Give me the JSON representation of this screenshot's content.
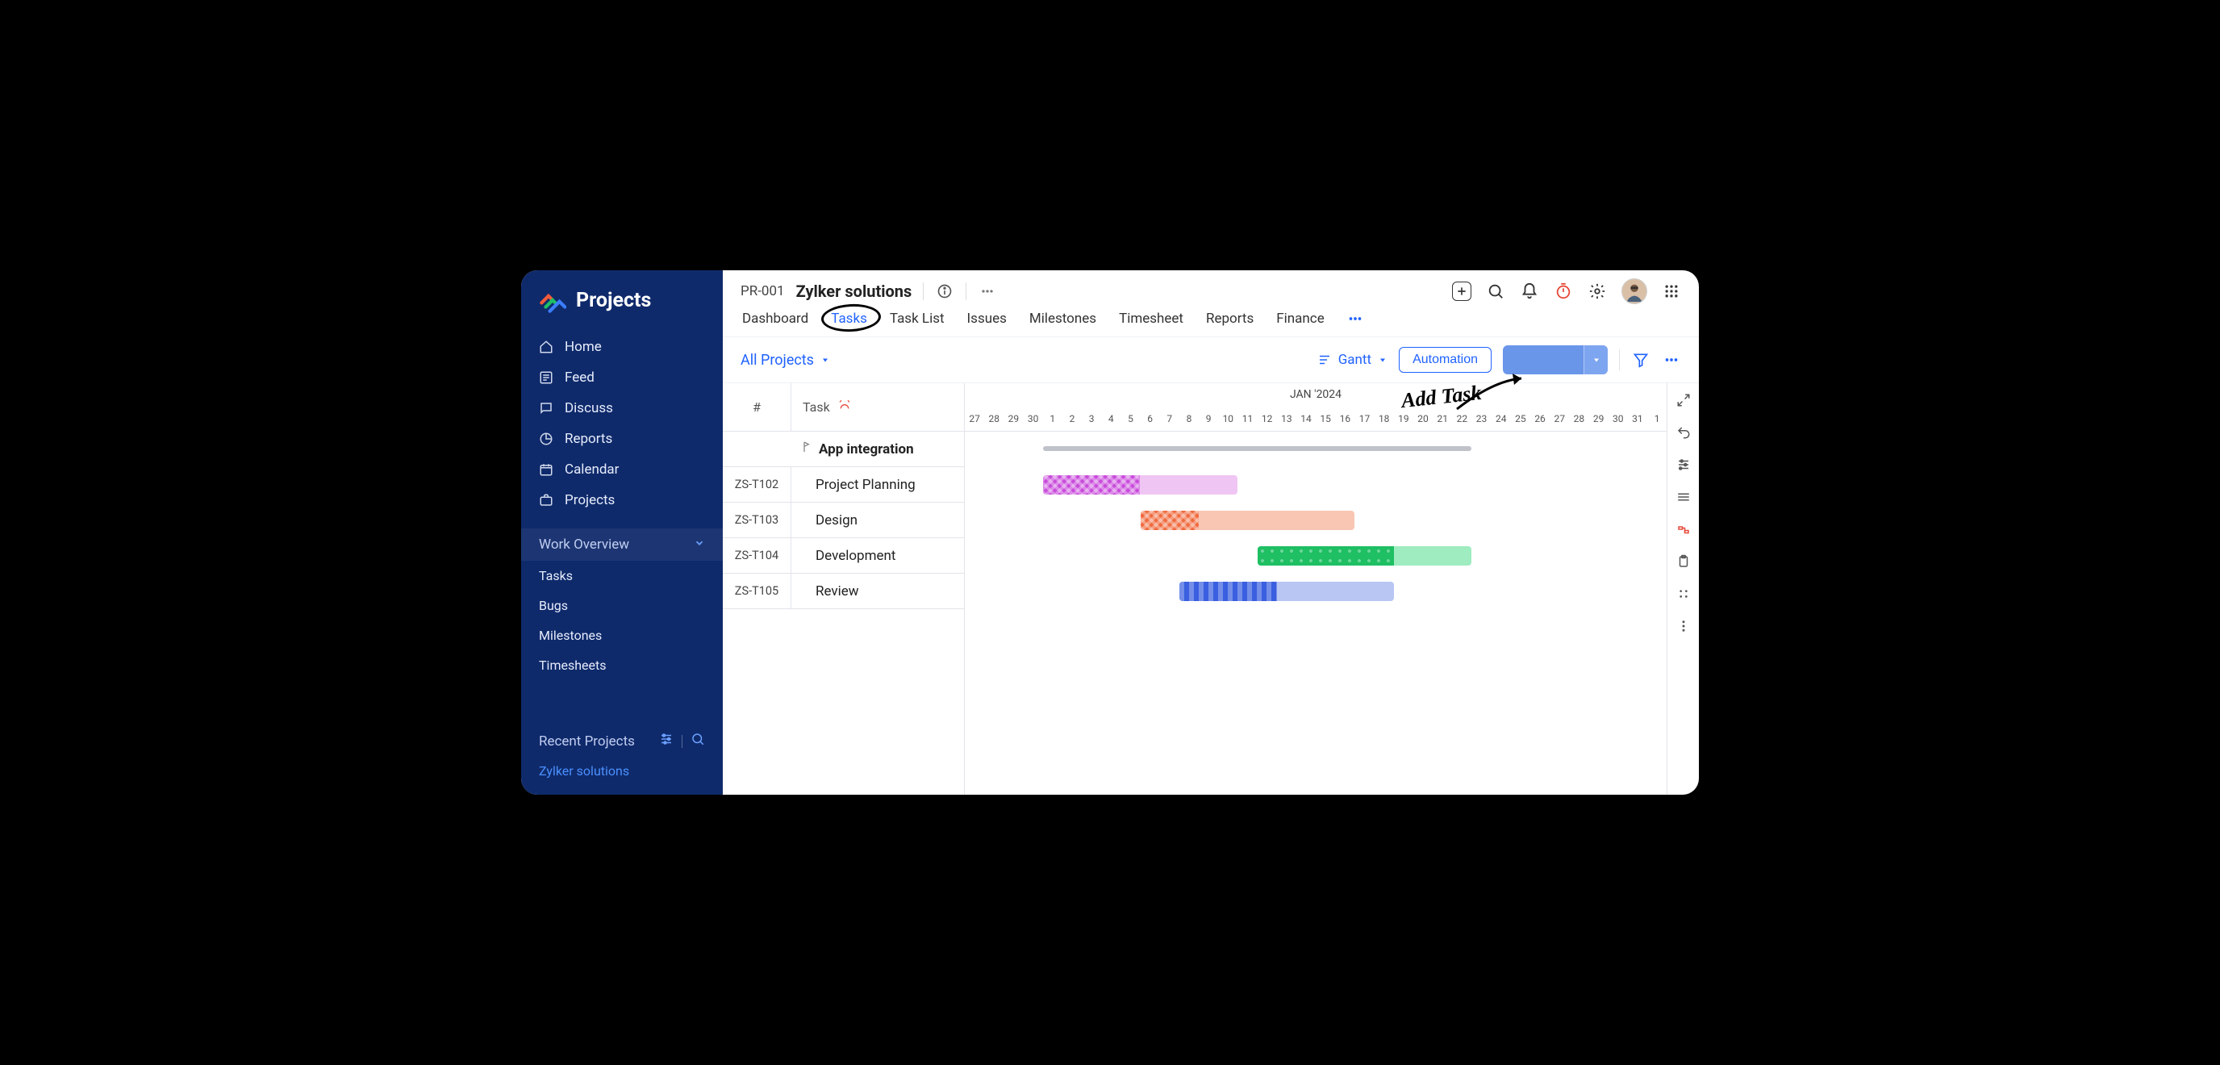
{
  "brand": "Projects",
  "sidebar": {
    "nav": [
      {
        "label": "Home",
        "icon": "home"
      },
      {
        "label": "Feed",
        "icon": "feed"
      },
      {
        "label": "Discuss",
        "icon": "discuss"
      },
      {
        "label": "Reports",
        "icon": "reports"
      },
      {
        "label": "Calendar",
        "icon": "calendar"
      },
      {
        "label": "Projects",
        "icon": "projects"
      }
    ],
    "section": "Work Overview",
    "sub": [
      "Tasks",
      "Bugs",
      "Milestones",
      "Timesheets"
    ],
    "recent_header": "Recent Projects",
    "recent": [
      "Zylker solutions"
    ]
  },
  "project": {
    "code": "PR-001",
    "name": "Zylker solutions"
  },
  "tabs": [
    "Dashboard",
    "Tasks",
    "Task List",
    "Issues",
    "Milestones",
    "Timesheet",
    "Reports",
    "Finance"
  ],
  "active_tab": "Tasks",
  "toolbar": {
    "scope": "All Projects",
    "view": "Gantt",
    "automation": "Automation"
  },
  "gantt": {
    "month": "JAN '2024",
    "days": [
      27,
      28,
      29,
      30,
      1,
      2,
      3,
      4,
      5,
      6,
      7,
      8,
      9,
      10,
      11,
      12,
      13,
      14,
      15,
      16,
      17,
      18,
      19,
      20,
      21,
      22,
      23,
      24,
      25,
      26,
      27,
      28,
      29,
      30,
      31,
      1
    ],
    "id_header": "#",
    "task_header": "Task",
    "group": "App integration",
    "rows": [
      {
        "id": "ZS-T102",
        "name": "Project Planning",
        "start": 4,
        "full": 14,
        "prog_end": 9,
        "c1": "#c94bdc",
        "c2": "#efc6f3"
      },
      {
        "id": "ZS-T103",
        "name": "Design",
        "start": 9,
        "full": 20,
        "prog_end": 12,
        "c1": "#f06a3e",
        "c2": "#f8c6b3"
      },
      {
        "id": "ZS-T104",
        "name": "Development",
        "start": 15,
        "full": 26,
        "prog_end": 22,
        "c1": "#1fbf63",
        "c2": "#9fecc0"
      },
      {
        "id": "ZS-T105",
        "name": "Review",
        "start": 11,
        "full": 22,
        "prog_end": 16,
        "c1": "#3a5fe0",
        "c2": "#b9c6f3"
      }
    ]
  },
  "annotation": "Add Task",
  "chart_data": {
    "type": "gantt",
    "title": "App integration — Gantt",
    "xlabel": "JAN '2024",
    "x_range": [
      "2023-12-27",
      "2024-02-01"
    ],
    "series": [
      {
        "id": "ZS-T102",
        "name": "Project Planning",
        "start": "2024-01-01",
        "end": "2024-01-14",
        "progress_end": "2024-01-06",
        "color": "#c94bdc"
      },
      {
        "id": "ZS-T103",
        "name": "Design",
        "start": "2024-01-06",
        "end": "2024-01-20",
        "progress_end": "2024-01-09",
        "color": "#f06a3e"
      },
      {
        "id": "ZS-T104",
        "name": "Development",
        "start": "2024-01-15",
        "end": "2024-01-26",
        "progress_end": "2024-01-22",
        "color": "#1fbf63"
      },
      {
        "id": "ZS-T105",
        "name": "Review",
        "start": "2024-01-08",
        "end": "2024-01-22",
        "progress_end": "2024-01-13",
        "color": "#3a5fe0"
      }
    ]
  }
}
